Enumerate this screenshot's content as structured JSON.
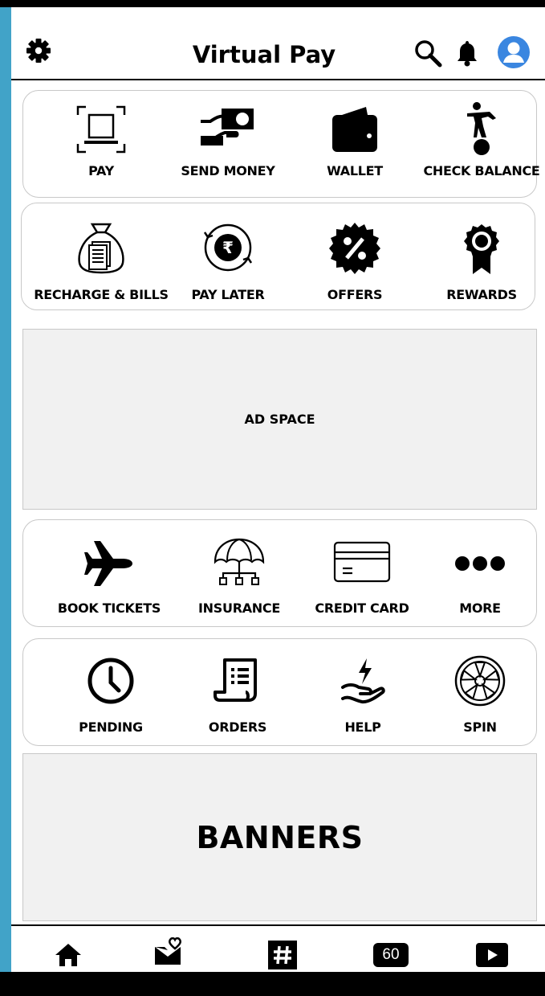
{
  "app": {
    "title": "Virtual Pay"
  },
  "header": {
    "left_icon": "gear-icon",
    "right_icons": [
      "search-icon",
      "bell-icon",
      "profile-avatar-icon"
    ],
    "accent": "#3a86e0"
  },
  "row1": [
    {
      "label": "PAY",
      "icon": "scan-icon"
    },
    {
      "label": "SEND MONEY",
      "icon": "hand-money-icon"
    },
    {
      "label": "WALLET",
      "icon": "wallet-icon"
    },
    {
      "label": "CHECK BALANCE",
      "icon": "balance-figure-icon"
    }
  ],
  "row2": [
    {
      "label": "RECHARGE & BILLS",
      "icon": "money-bag-icon"
    },
    {
      "label": "PAY LATER",
      "icon": "rupee-cycle-icon"
    },
    {
      "label": "OFFERS",
      "icon": "percent-badge-icon"
    },
    {
      "label": "REWARDS",
      "icon": "ribbon-medal-icon"
    }
  ],
  "ad": {
    "label": "AD SPACE"
  },
  "row3": [
    {
      "label": "BOOK TICKETS",
      "icon": "airplane-icon"
    },
    {
      "label": "INSURANCE",
      "icon": "umbrella-network-icon"
    },
    {
      "label": "CREDIT CARD",
      "icon": "credit-card-icon"
    },
    {
      "label": "MORE",
      "icon": "more-dots-icon"
    }
  ],
  "row4": [
    {
      "label": "PENDING",
      "icon": "clock-icon"
    },
    {
      "label": "ORDERS",
      "icon": "receipt-icon"
    },
    {
      "label": "HELP",
      "icon": "helping-hand-icon"
    },
    {
      "label": "SPIN",
      "icon": "spin-wheel-icon"
    }
  ],
  "banner": {
    "label": "BANNERS"
  },
  "bottom_nav": {
    "items": [
      {
        "icon": "home-icon"
      },
      {
        "icon": "mail-heart-icon"
      },
      {
        "icon": "hashtag-icon"
      },
      {
        "icon": "counter-badge-icon",
        "text": "60"
      },
      {
        "icon": "play-icon"
      }
    ]
  },
  "colors": {
    "frame": "#41a3c8",
    "card_border": "#c8c8c8",
    "ad_bg": "#f1f1f1"
  }
}
